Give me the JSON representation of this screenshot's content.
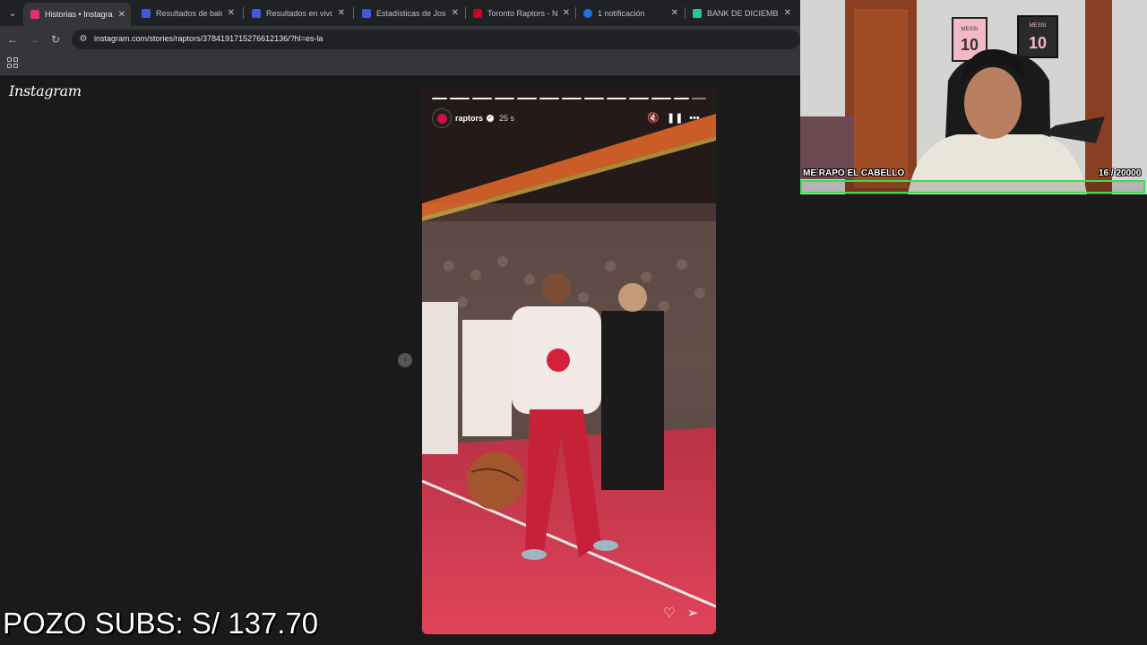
{
  "browser": {
    "tabs": [
      {
        "title": "Historias • Instagram",
        "favicon_color": "#e1306c",
        "active": true
      },
      {
        "title": "Resultados de balonc",
        "favicon_color": "#3b5bdb",
        "active": false
      },
      {
        "title": "Resultados en vivo y",
        "favicon_color": "#3b5bdb",
        "active": false
      },
      {
        "title": "Estadísticas de Josh H",
        "favicon_color": "#3b5bdb",
        "active": false
      },
      {
        "title": "Toronto Raptors - Ne",
        "favicon_color": "#d0021b",
        "active": false
      },
      {
        "title": "1 notificación",
        "favicon_color": "#1a73e8",
        "active": false
      },
      {
        "title": "BANK DE DICIEMBRE",
        "favicon_color": "#20c997",
        "active": false
      }
    ],
    "url": "instagram.com/stories/raptors/3784191715276612136/?hl=es-la"
  },
  "instagram": {
    "logo": "Instagram",
    "story": {
      "username": "raptors",
      "time": "25 s",
      "segments_total": 13,
      "segments_viewed": 12
    }
  },
  "overlay": {
    "subs_text": "POZO SUBS: S/ 137.70",
    "goal_label": "ME RAPO EL CABELLO",
    "goal_count": "16   / 20000",
    "goal_progress": 0.0008,
    "goal_color": "#3ddc52",
    "jersey_text": "MESSI",
    "jersey_number": "10"
  },
  "icons": [
    "tab-list-icon",
    "back-icon",
    "forward-icon",
    "reload-icon",
    "site-info-icon",
    "apps-icon",
    "prev-story-icon",
    "mute-icon",
    "pause-icon",
    "more-icon",
    "heart-icon",
    "share-icon",
    "verified-icon",
    "close-icon"
  ]
}
